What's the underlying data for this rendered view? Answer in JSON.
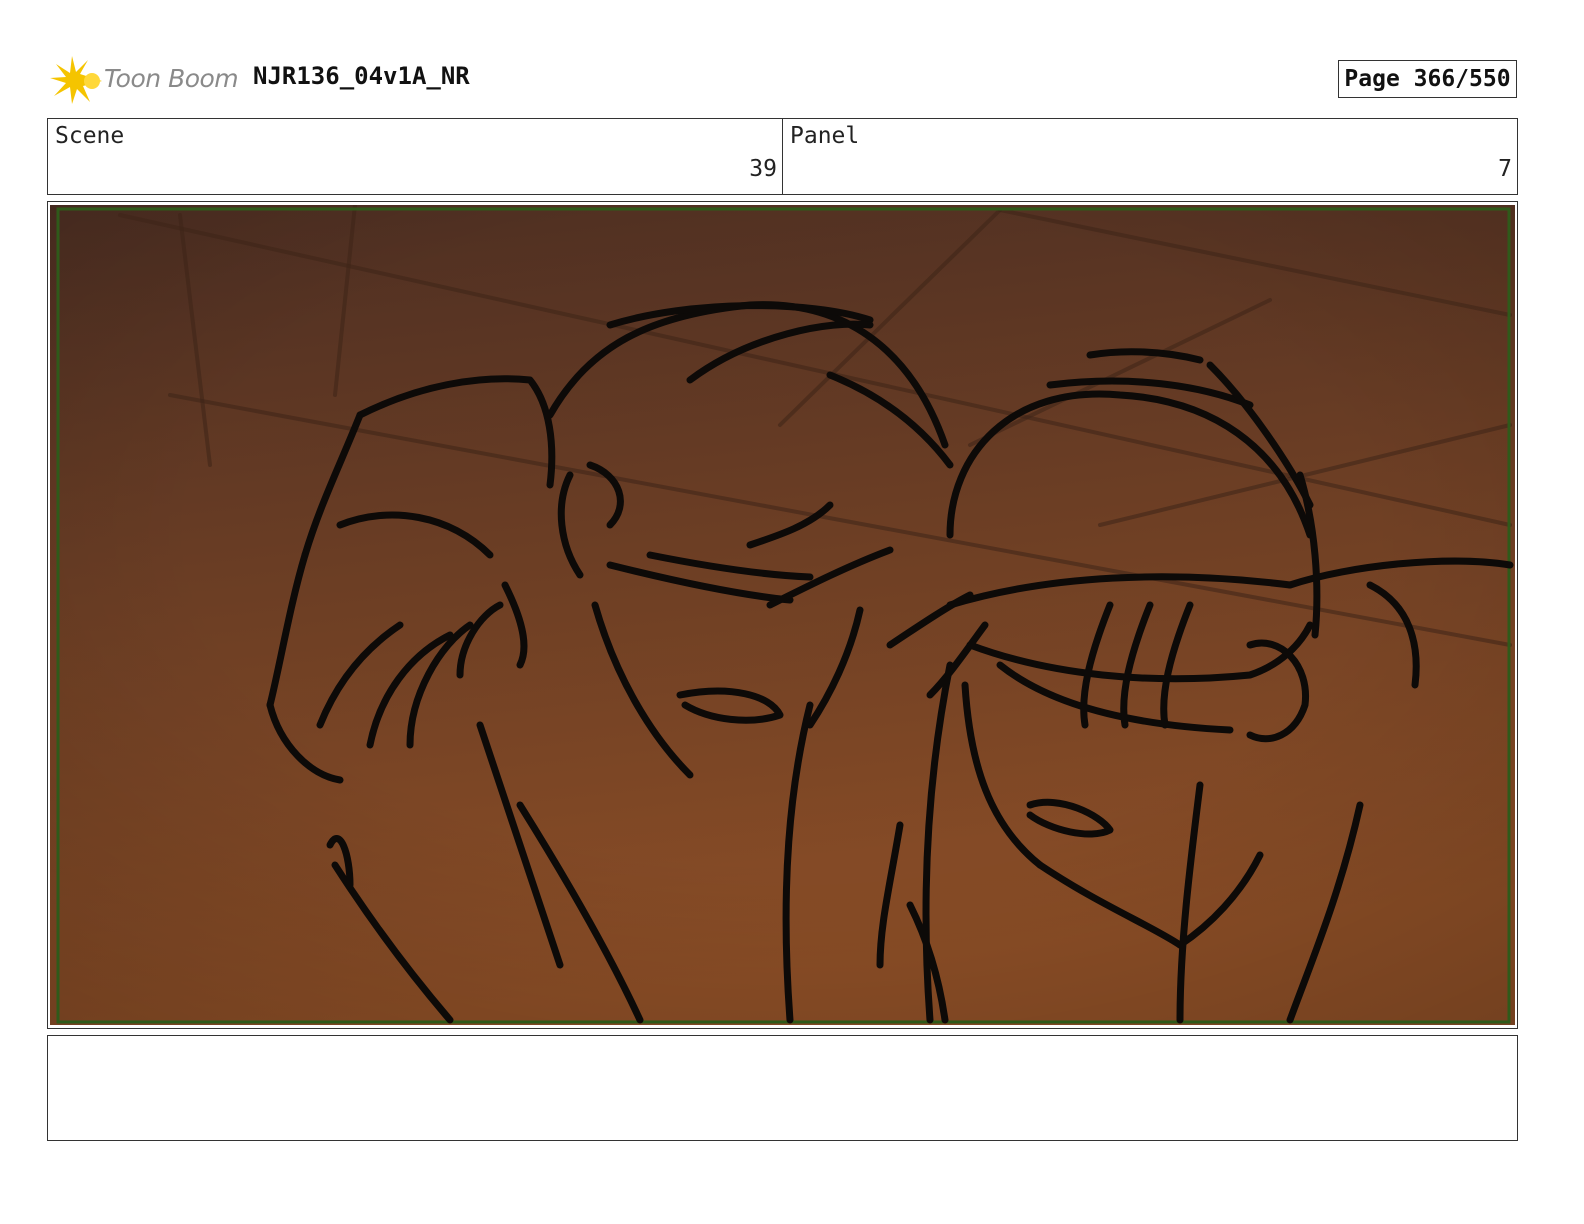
{
  "header": {
    "logo_text": "Toon Boom",
    "title": "NJR136_04v1A_NR",
    "page_label": "Page 366/550"
  },
  "info": {
    "scene_label": "Scene",
    "scene_value": "39",
    "panel_label": "Panel",
    "panel_value": "7"
  },
  "icons": {
    "logo": "toon-boom-burst-icon"
  },
  "colors": {
    "frame_border": "#2f5a1a",
    "bg_top": "#4e2f22",
    "bg_bottom": "#8a4d26",
    "sketch_ink": "#0d0a08",
    "logo_yellow": "#f5c400"
  }
}
